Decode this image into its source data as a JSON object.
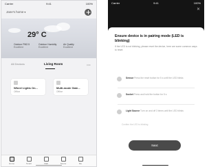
{
  "left_screen": {
    "status_bar": {
      "carrier": "Carrier",
      "time": "9:41",
      "battery": "100%"
    },
    "home_title": "Jane's home",
    "temperature": "29° C",
    "weather_metrics": [
      {
        "label": "Outdoor PM2.5",
        "value": "Excellent"
      },
      {
        "label": "Outdoor Humidity",
        "value": "Excellent"
      },
      {
        "label": "Air Quality",
        "value": "Excellent"
      }
    ],
    "tabs": [
      "All Devices",
      "Living Room"
    ],
    "devices": [
      {
        "name": "Wheel Lights On...",
        "status": "Offline"
      },
      {
        "name": "Multi-mode Gate...",
        "status": "Offline"
      }
    ],
    "nav_items": [
      "Home",
      "Smart",
      "Mall",
      "Scene",
      "Me"
    ]
  },
  "right_screen": {
    "status_bar": {
      "carrier": "Carrier",
      "time": "9:41",
      "battery": "100%"
    },
    "sheet_title": "Ensure device is in pairing mode (LED is blinking)",
    "sheet_description": "If the LED is not blinking, please reset the device, here are some common ways to reset:",
    "methods": [
      {
        "name": "Sensor",
        "detail": "Press the reset button for 5 s until the LED blinks"
      },
      {
        "name": "Socket",
        "detail": "Press and hold the button for 5 s"
      },
      {
        "name": "Light Source",
        "detail": "Turn on and off 3 times until the LED blinks"
      }
    ],
    "hint": "Confirm the LED is blinking",
    "next_label": "Next"
  }
}
